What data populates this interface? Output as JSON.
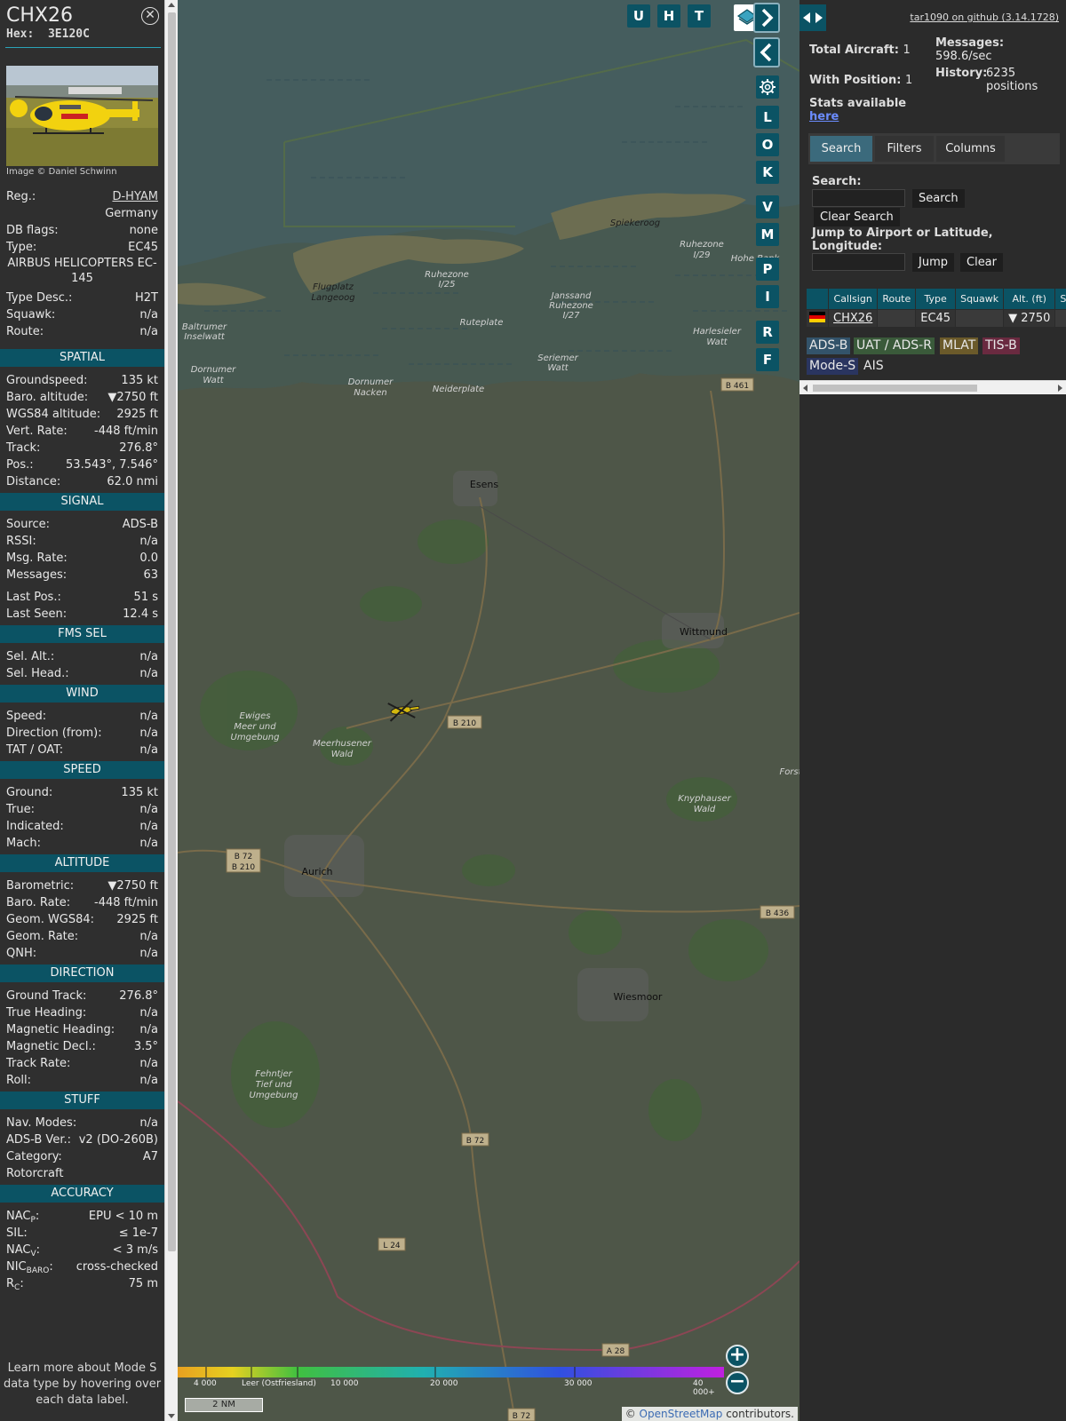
{
  "aircraft": {
    "callsign": "CHX26",
    "hex_label": "Hex:",
    "hex": "3E120C",
    "image_credit": "Image © Daniel Schwinn"
  },
  "details": [
    {
      "key": "Reg.:",
      "value": "D-HYAM",
      "link": true
    },
    {
      "key": "",
      "value": "Germany"
    },
    {
      "key": "DB flags:",
      "value": "none"
    },
    {
      "key": "Type:",
      "value": "EC45"
    }
  ],
  "type_full": "AIRBUS HELICOPTERS EC-145",
  "details2": [
    {
      "key": "Type Desc.:",
      "value": "H2T"
    },
    {
      "key": "Squawk:",
      "value": "n/a"
    },
    {
      "key": "Route:",
      "value": "n/a"
    }
  ],
  "sections": [
    {
      "title": "SPATIAL",
      "rows": [
        {
          "key": "Groundspeed:",
          "value": "135 kt"
        },
        {
          "key": "Baro. altitude:",
          "value": "▼2750 ft"
        },
        {
          "key": "WGS84 altitude:",
          "value": "2925 ft"
        },
        {
          "key": "Vert. Rate:",
          "value": "-448 ft/min"
        },
        {
          "key": "Track:",
          "value": "276.8°"
        },
        {
          "key": "Pos.:",
          "value": "53.543°, 7.546°"
        },
        {
          "key": "Distance:",
          "value": "62.0 nmi"
        }
      ]
    },
    {
      "title": "SIGNAL",
      "rows": [
        {
          "key": "Source:",
          "value": "ADS-B"
        },
        {
          "key": "RSSI:",
          "value": "n/a"
        },
        {
          "key": "Msg. Rate:",
          "value": "0.0"
        },
        {
          "key": "Messages:",
          "value": "63"
        },
        {
          "key": "",
          "value": ""
        },
        {
          "key": "Last Pos.:",
          "value": "51 s"
        },
        {
          "key": "Last Seen:",
          "value": "12.4 s"
        }
      ]
    },
    {
      "title": "FMS SEL",
      "rows": [
        {
          "key": "Sel. Alt.:",
          "value": "n/a"
        },
        {
          "key": "Sel. Head.:",
          "value": "n/a"
        }
      ]
    },
    {
      "title": "WIND",
      "rows": [
        {
          "key": "Speed:",
          "value": "n/a"
        },
        {
          "key": "Direction (from):",
          "value": "n/a"
        },
        {
          "key": "TAT / OAT:",
          "value": "n/a"
        }
      ]
    },
    {
      "title": "SPEED",
      "rows": [
        {
          "key": "Ground:",
          "value": "135 kt"
        },
        {
          "key": "True:",
          "value": "n/a"
        },
        {
          "key": "Indicated:",
          "value": "n/a"
        },
        {
          "key": "Mach:",
          "value": "n/a"
        }
      ]
    },
    {
      "title": "ALTITUDE",
      "rows": [
        {
          "key": "Barometric:",
          "value": "▼2750 ft"
        },
        {
          "key": "Baro. Rate:",
          "value": "-448 ft/min"
        },
        {
          "key": "Geom. WGS84:",
          "value": "2925 ft"
        },
        {
          "key": "Geom. Rate:",
          "value": "n/a"
        },
        {
          "key": "QNH:",
          "value": "n/a"
        }
      ]
    },
    {
      "title": "DIRECTION",
      "rows": [
        {
          "key": "Ground Track:",
          "value": "276.8°"
        },
        {
          "key": "True Heading:",
          "value": "n/a"
        },
        {
          "key": "Magnetic Heading:",
          "value": "n/a"
        },
        {
          "key": "Magnetic Decl.:",
          "value": "3.5°"
        },
        {
          "key": "Track Rate:",
          "value": "n/a"
        },
        {
          "key": "Roll:",
          "value": "n/a"
        }
      ]
    },
    {
      "title": "STUFF",
      "rows": [
        {
          "key": "Nav. Modes:",
          "value": "n/a"
        },
        {
          "key": "ADS-B Ver.:",
          "value": "v2 (DO-260B)"
        },
        {
          "key": "Category:",
          "value": "A7"
        },
        {
          "key": "Rotorcraft",
          "value": ""
        }
      ]
    },
    {
      "title": "ACCURACY",
      "rows": [
        {
          "key": "NAC",
          "sub": "P",
          "value": "EPU < 10 m"
        },
        {
          "key": "SIL:",
          "value": "≤ 1e-7"
        },
        {
          "key": "NAC",
          "sub": "V",
          "value": "< 3 m/s"
        },
        {
          "key": "NIC",
          "sub": "BARO",
          "value": "cross-checked"
        },
        {
          "key": "R",
          "sub": "C",
          "value": "75 m"
        }
      ]
    }
  ],
  "learn_more": "Learn more about Mode S data type by hovering over each data label.",
  "map": {
    "buttons_top": [
      "U",
      "H",
      "T"
    ],
    "buttons_side": [
      "L",
      "O",
      "K",
      "V",
      "M",
      "P",
      "I",
      "R",
      "F"
    ],
    "places": [
      "Spiekeroog",
      "Ruhezone I/29",
      "Hohe Bank",
      "Flugplatz Langeoog",
      "Ruhezone I/25",
      "Janssand Ruhezone I/27",
      "Ruteplate",
      "Baltrumer Inselwatt",
      "Seriemer Watt",
      "Harlesieler Watt",
      "Dornumer Watt",
      "Dornumer Nacken",
      "Neiderplate",
      "Esens",
      "Wittmund",
      "Ewiges Meer und Umgebung",
      "Meerhusener Wald",
      "Knyphauser Wald",
      "Aurich",
      "Wiesmoor",
      "Fehntjer Tief und Umgebung",
      "Forst"
    ],
    "roads": [
      "B 461",
      "B 210",
      "B 72",
      "B 210",
      "B 436",
      "B 72",
      "L 24",
      "A 28",
      "B 72"
    ],
    "scale": "2 NM",
    "attribution_pre": "© ",
    "attribution_link": "OpenStreetMap",
    "attribution_post": " contributors.",
    "colorbar_labels": [
      "4 000",
      "Leer (Ostfriesland)",
      "10 000",
      "20 000",
      "30 000",
      "40 000+"
    ],
    "colors": {
      "water": "#4f6a6c",
      "land": "#596252",
      "forest": "#4f6b45",
      "primary": "#0b5364"
    }
  },
  "right": {
    "github": "tar1090 on github (3.14.1728)",
    "total_aircraft_label": "Total Aircraft:",
    "total_aircraft": "1",
    "with_position_label": "With Position:",
    "with_position": "1",
    "stats_label": "Stats available",
    "stats_link": "here",
    "messages_label": "Messages:",
    "messages": "598.6/sec",
    "history_label": "History:",
    "history": "6235 positions",
    "tabs": [
      "Search",
      "Filters",
      "Columns"
    ],
    "search_label": "Search:",
    "search_button": "Search",
    "clear_search_button": "Clear Search",
    "jump_label": "Jump to Airport or Latitude, Longitude:",
    "jump_button": "Jump",
    "clear_button": "Clear",
    "table_headers": [
      "",
      "Callsign",
      "Route",
      "Type",
      "Squawk",
      "Alt. (ft)",
      "Spd"
    ],
    "table_rows": [
      [
        "",
        "CHX26",
        "",
        "EC45",
        "",
        "▼ 2750",
        ""
      ]
    ],
    "badges": [
      "ADS-B",
      "UAT / ADS-R",
      "MLAT",
      "TIS-B",
      "Mode-S",
      "AIS"
    ]
  }
}
